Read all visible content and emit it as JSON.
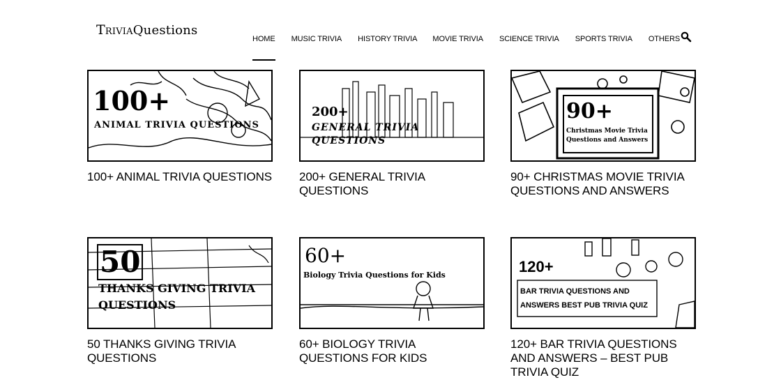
{
  "site": {
    "logo_first": "Trivia",
    "logo_second": "Questions"
  },
  "nav": {
    "items": [
      {
        "label": "HOME",
        "active": true
      },
      {
        "label": "MUSIC TRIVIA",
        "active": false
      },
      {
        "label": "HISTORY TRIVIA",
        "active": false
      },
      {
        "label": "MOVIE TRIVIA",
        "active": false
      },
      {
        "label": "SCIENCE TRIVIA",
        "active": false
      },
      {
        "label": "SPORTS TRIVIA",
        "active": false
      },
      {
        "label": "OTHERS",
        "active": false
      }
    ],
    "search_icon": "search-icon"
  },
  "posts": [
    {
      "title": "100+ ANIMAL TRIVIA QUESTIONS",
      "thumb_big": "100+",
      "thumb_small": "ANIMAL TRIVIA QUESTIONS"
    },
    {
      "title": "200+ GENERAL TRIVIA QUESTIONS",
      "thumb_big": "200+",
      "thumb_small": "GENERAL TRIVIA QUESTIONS"
    },
    {
      "title": "90+ CHRISTMAS MOVIE TRIVIA QUESTIONS AND ANSWERS",
      "thumb_big": "90+",
      "thumb_small": "Christmas Movie Trivia Questions and Answers"
    },
    {
      "title": "50 THANKS GIVING TRIVIA QUESTIONS",
      "thumb_big": "50",
      "thumb_small": "THANKS GIVING TRIVIA QUESTIONS"
    },
    {
      "title": "60+ BIOLOGY TRIVIA QUESTIONS FOR KIDS",
      "thumb_big": "60+",
      "thumb_small": "Biology Trivia Questions for Kids"
    },
    {
      "title": "120+ BAR TRIVIA QUESTIONS AND ANSWERS – BEST PUB TRIVIA QUIZ",
      "thumb_big": "120+",
      "thumb_small": "BAR TRIVIA QUESTIONS AND ANSWERS BEST PUB TRIVIA QUIZ"
    }
  ]
}
